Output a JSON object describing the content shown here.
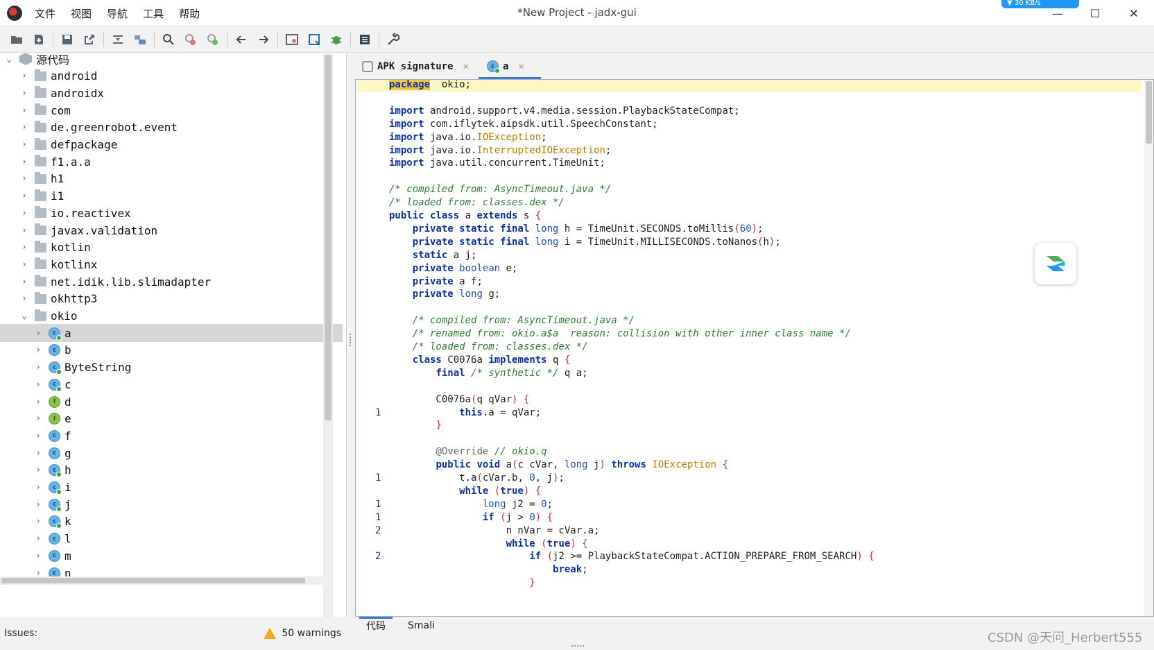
{
  "window": {
    "title": "*New Project - jadx-gui",
    "menu": [
      "文件",
      "视图",
      "导航",
      "工具",
      "帮助"
    ],
    "badge_text": "▼ 30 KB/s"
  },
  "toolbar": {
    "buttons": [
      "open-file",
      "add-files",
      "save-all",
      "export",
      "sync-editor",
      "flatten-packages",
      "search",
      "find-class",
      "find-usage",
      "back",
      "forward",
      "deobfuscation",
      "quark",
      "debugger",
      "log-viewer",
      "preferences"
    ]
  },
  "tree": {
    "root_label": "源代码",
    "packages": [
      "android",
      "androidx",
      "com",
      "de.greenrobot.event",
      "defpackage",
      "f1.a.a",
      "h1",
      "i1",
      "io.reactivex",
      "javax.validation",
      "kotlin",
      "kotlinx",
      "net.idik.lib.slimadapter",
      "okhttp3",
      "okio"
    ],
    "okio_children": [
      {
        "label": "a",
        "kind": "class",
        "dot": true,
        "selected": true
      },
      {
        "label": "b",
        "kind": "class",
        "dot": false
      },
      {
        "label": "ByteString",
        "kind": "class",
        "dot": true
      },
      {
        "label": "c",
        "kind": "class",
        "dot": true
      },
      {
        "label": "d",
        "kind": "interface",
        "dot": false
      },
      {
        "label": "e",
        "kind": "interface",
        "dot": false
      },
      {
        "label": "f",
        "kind": "class",
        "dot": false
      },
      {
        "label": "g",
        "kind": "class",
        "dot": false
      },
      {
        "label": "h",
        "kind": "class",
        "dot": true
      },
      {
        "label": "i",
        "kind": "class",
        "dot": true
      },
      {
        "label": "j",
        "kind": "class",
        "dot": true
      },
      {
        "label": "k",
        "kind": "class",
        "dot": true
      },
      {
        "label": "l",
        "kind": "class",
        "dot": false
      },
      {
        "label": "m",
        "kind": "class",
        "dot": false
      },
      {
        "label": "n",
        "kind": "class",
        "dot": false
      }
    ]
  },
  "tabs": [
    {
      "label": "APK signature",
      "active": false
    },
    {
      "label": "a",
      "active": true
    }
  ],
  "code": [
    {
      "n": "",
      "t": [
        [
          "kh",
          "package"
        ],
        [
          "",
          "  okio;"
        ]
      ],
      "hl": true
    },
    {
      "n": "",
      "t": []
    },
    {
      "n": "",
      "t": [
        [
          "k",
          "import"
        ],
        [
          "",
          " android.support.v4.media.session.PlaybackStateCompat;"
        ]
      ]
    },
    {
      "n": "",
      "t": [
        [
          "k",
          "import"
        ],
        [
          "",
          " com.iflytek.aipsdk.util.SpeechConstant;"
        ]
      ]
    },
    {
      "n": "",
      "t": [
        [
          "k",
          "import"
        ],
        [
          "",
          " java.io."
        ],
        [
          "e",
          "IOException"
        ],
        [
          "",
          ";"
        ]
      ]
    },
    {
      "n": "",
      "t": [
        [
          "k",
          "import"
        ],
        [
          "",
          " java.io."
        ],
        [
          "e",
          "InterruptedIOException"
        ],
        [
          "",
          ";"
        ]
      ]
    },
    {
      "n": "",
      "t": [
        [
          "k",
          "import"
        ],
        [
          "",
          " java.util.concurrent.TimeUnit;"
        ]
      ]
    },
    {
      "n": "",
      "t": []
    },
    {
      "n": "",
      "t": [
        [
          "c",
          "/* compiled from: AsyncTimeout.java */"
        ]
      ]
    },
    {
      "n": "",
      "t": [
        [
          "c",
          "/* loaded from: classes.dex */"
        ]
      ]
    },
    {
      "n": "",
      "t": [
        [
          "k",
          "public class"
        ],
        [
          "",
          " a "
        ],
        [
          "k",
          "extends"
        ],
        [
          "",
          " s "
        ],
        [
          "b",
          "{"
        ]
      ]
    },
    {
      "n": "",
      "t": [
        [
          "",
          "    "
        ],
        [
          "k",
          "private static final"
        ],
        [
          " n",
          " "
        ],
        [
          "n",
          "long"
        ],
        [
          "",
          " h = TimeUnit.SECONDS.toMillis"
        ],
        [
          "b",
          "("
        ],
        [
          "n",
          "60"
        ],
        [
          "b",
          ")"
        ],
        [
          "",
          ";"
        ]
      ]
    },
    {
      "n": "",
      "t": [
        [
          "",
          "    "
        ],
        [
          "k",
          "private static final"
        ],
        [
          "",
          " "
        ],
        [
          "n",
          "long"
        ],
        [
          "",
          " i = TimeUnit.MILLISECONDS.toNanos"
        ],
        [
          "b",
          "("
        ],
        [
          "",
          "h"
        ],
        [
          "b",
          ")"
        ],
        [
          "",
          ";"
        ]
      ]
    },
    {
      "n": "",
      "t": [
        [
          "",
          "    "
        ],
        [
          "k",
          "static"
        ],
        [
          "",
          " a j;"
        ]
      ]
    },
    {
      "n": "",
      "t": [
        [
          "",
          "    "
        ],
        [
          "k",
          "private"
        ],
        [
          "",
          " "
        ],
        [
          "n",
          "boolean"
        ],
        [
          "",
          " e;"
        ]
      ]
    },
    {
      "n": "",
      "t": [
        [
          "",
          "    "
        ],
        [
          "k",
          "private"
        ],
        [
          "",
          " a f;"
        ]
      ]
    },
    {
      "n": "",
      "t": [
        [
          "",
          "    "
        ],
        [
          "k",
          "private"
        ],
        [
          "",
          " "
        ],
        [
          "n",
          "long"
        ],
        [
          "",
          " g;"
        ]
      ]
    },
    {
      "n": "",
      "t": []
    },
    {
      "n": "",
      "t": [
        [
          "",
          "    "
        ],
        [
          "c",
          "/* compiled from: AsyncTimeout.java */"
        ]
      ]
    },
    {
      "n": "",
      "t": [
        [
          "",
          "    "
        ],
        [
          "c",
          "/* renamed from: okio.a$a  reason: collision with other inner class name */"
        ]
      ]
    },
    {
      "n": "",
      "t": [
        [
          "",
          "    "
        ],
        [
          "c",
          "/* loaded from: classes.dex */"
        ]
      ]
    },
    {
      "n": "",
      "t": [
        [
          "",
          "    "
        ],
        [
          "k",
          "class"
        ],
        [
          "",
          " C0076a "
        ],
        [
          "k",
          "implements"
        ],
        [
          "",
          " q "
        ],
        [
          "b",
          "{"
        ]
      ]
    },
    {
      "n": "",
      "t": [
        [
          "",
          "        "
        ],
        [
          "k",
          "final"
        ],
        [
          "",
          " "
        ],
        [
          "c",
          "/* synthetic */"
        ],
        [
          "",
          " q a;"
        ]
      ]
    },
    {
      "n": "",
      "t": []
    },
    {
      "n": "",
      "t": [
        [
          "",
          "        C0076a"
        ],
        [
          "b",
          "("
        ],
        [
          "",
          "q qVar"
        ],
        [
          "b",
          ")"
        ],
        [
          "",
          " "
        ],
        [
          "b",
          "{"
        ]
      ]
    },
    {
      "n": "1",
      "t": [
        [
          "",
          "            "
        ],
        [
          "k",
          "this"
        ],
        [
          "",
          ".a = qVar;"
        ]
      ]
    },
    {
      "n": "",
      "t": [
        [
          "",
          "        "
        ],
        [
          "b",
          "}"
        ]
      ]
    },
    {
      "n": "",
      "t": []
    },
    {
      "n": "",
      "t": [
        [
          "",
          "        "
        ],
        [
          "a",
          "@Override"
        ],
        [
          "",
          " "
        ],
        [
          "c",
          "// okio.q"
        ]
      ]
    },
    {
      "n": "",
      "t": [
        [
          "",
          "        "
        ],
        [
          "k",
          "public void"
        ],
        [
          "",
          " a"
        ],
        [
          "b",
          "("
        ],
        [
          "",
          "c cVar, "
        ],
        [
          "n",
          "long"
        ],
        [
          "",
          " j"
        ],
        [
          "b",
          ")"
        ],
        [
          "",
          " "
        ],
        [
          "k",
          "throws"
        ],
        [
          "",
          " "
        ],
        [
          "e",
          "IOException"
        ],
        [
          "",
          " "
        ],
        [
          "b",
          "{"
        ]
      ]
    },
    {
      "n": "1",
      "t": [
        [
          "",
          "            t.a"
        ],
        [
          "b",
          "("
        ],
        [
          "",
          "cVar.b, "
        ],
        [
          "n",
          "0"
        ],
        [
          "",
          ", j"
        ],
        [
          "b",
          ")"
        ],
        [
          "",
          ";"
        ]
      ]
    },
    {
      "n": "",
      "t": [
        [
          "",
          "            "
        ],
        [
          "k",
          "while"
        ],
        [
          "",
          " "
        ],
        [
          "b",
          "("
        ],
        [
          "k",
          "true"
        ],
        [
          "b",
          ")"
        ],
        [
          "",
          " "
        ],
        [
          "b",
          "{"
        ]
      ]
    },
    {
      "n": "1",
      "t": [
        [
          "",
          "                "
        ],
        [
          "n",
          "long"
        ],
        [
          "",
          " j2 = "
        ],
        [
          "n",
          "0"
        ],
        [
          "",
          ";"
        ]
      ]
    },
    {
      "n": "1",
      "t": [
        [
          "",
          "                "
        ],
        [
          "k",
          "if"
        ],
        [
          "",
          " "
        ],
        [
          "b",
          "("
        ],
        [
          "",
          "j > "
        ],
        [
          "n",
          "0"
        ],
        [
          "b",
          ")"
        ],
        [
          "",
          " "
        ],
        [
          "b",
          "{"
        ]
      ]
    },
    {
      "n": "2",
      "t": [
        [
          "",
          "                    n nVar = cVar.a;"
        ]
      ]
    },
    {
      "n": "",
      "t": [
        [
          "",
          "                    "
        ],
        [
          "k",
          "while"
        ],
        [
          "",
          " "
        ],
        [
          "b",
          "("
        ],
        [
          "k",
          "true"
        ],
        [
          "b",
          ")"
        ],
        [
          "",
          " "
        ],
        [
          "b",
          "{"
        ]
      ]
    },
    {
      "n": "2",
      "t": [
        [
          "",
          "                        "
        ],
        [
          "k",
          "if"
        ],
        [
          "",
          " "
        ],
        [
          "b",
          "("
        ],
        [
          "",
          "j2 >= PlaybackStateCompat.ACTION_PREPARE_FROM_SEARCH"
        ],
        [
          "b",
          ")"
        ],
        [
          "",
          " "
        ],
        [
          "b",
          "{"
        ]
      ]
    },
    {
      "n": "",
      "t": [
        [
          "",
          "                            "
        ],
        [
          "k",
          "break"
        ],
        [
          "",
          ";"
        ]
      ]
    },
    {
      "n": "",
      "t": [
        [
          "",
          "                        "
        ],
        [
          "b",
          "}"
        ]
      ]
    }
  ],
  "bottom_tabs": [
    "代码",
    "Smali"
  ],
  "status": {
    "issues_label": "Issues:",
    "warnings": "50 warnings"
  },
  "watermark": "CSDN @天问_Herbert555"
}
